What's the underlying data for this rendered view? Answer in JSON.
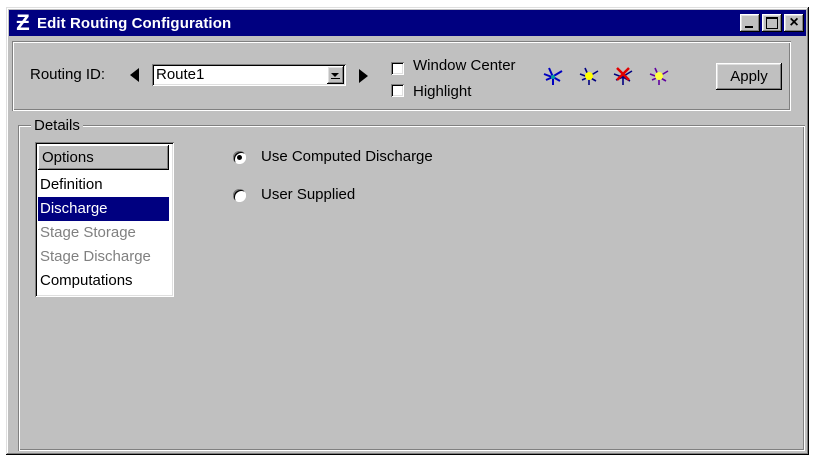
{
  "window": {
    "title": "Edit Routing Configuration",
    "icon": "z-logo-icon"
  },
  "toolbar": {
    "routing_label": "Routing ID:",
    "routing_value": "Route1",
    "window_center_label": "Window Center",
    "highlight_label": "Highlight",
    "apply_label": "Apply",
    "tool_icons": [
      "route-tool-blue-icon",
      "route-tool-yellow-icon",
      "route-tool-red-icon",
      "route-tool-purple-icon"
    ]
  },
  "details": {
    "legend": "Details",
    "options_header": "Options",
    "options": [
      {
        "label": "Definition",
        "state": "normal"
      },
      {
        "label": "Discharge",
        "state": "selected"
      },
      {
        "label": "Stage Storage",
        "state": "disabled"
      },
      {
        "label": "Stage Discharge",
        "state": "disabled"
      },
      {
        "label": "Computations",
        "state": "normal"
      }
    ],
    "radio_computed": "Use Computed Discharge",
    "radio_user": "User Supplied",
    "selected_radio": "Use Computed Discharge"
  },
  "colors": {
    "titlebar": "#000080",
    "face": "#c0c0c0",
    "selection": "#000080"
  }
}
